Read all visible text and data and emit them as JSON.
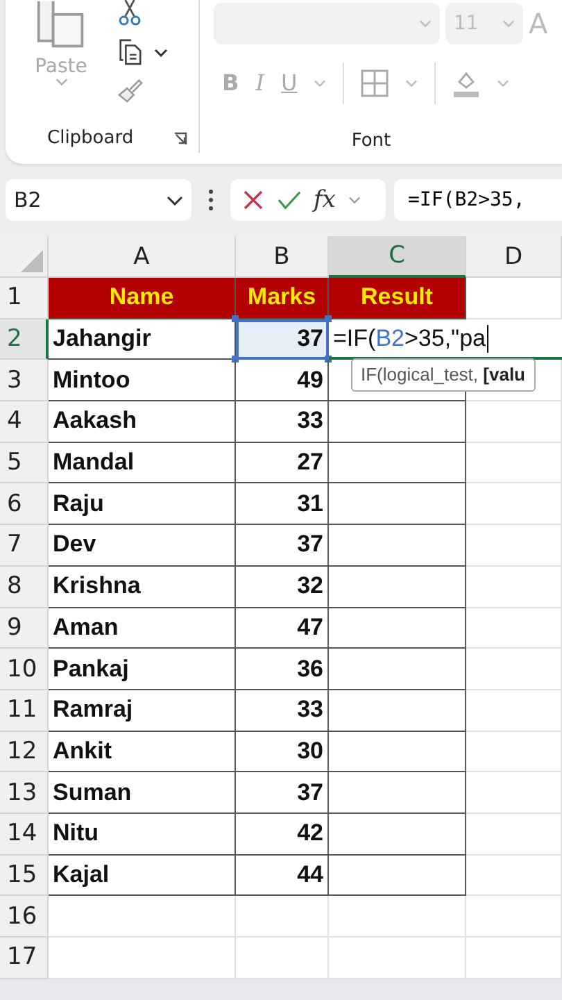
{
  "ribbon": {
    "clipboard": {
      "paste_label": "Paste",
      "group_label": "Clipboard"
    },
    "font": {
      "size": "11",
      "grow": "A",
      "bold": "B",
      "italic": "I",
      "underline": "U",
      "group_label": "Font"
    }
  },
  "formula_bar": {
    "name_box": "B2",
    "fx": "fx",
    "formula": "=IF(B2>35,"
  },
  "columns": [
    {
      "label": "A",
      "selected": false
    },
    {
      "label": "B",
      "selected": false
    },
    {
      "label": "C",
      "selected": true
    },
    {
      "label": "D",
      "selected": false
    }
  ],
  "edit_cell": {
    "parts": [
      {
        "kind": "plain",
        "text": "=IF("
      },
      {
        "kind": "ref",
        "text": "B2"
      },
      {
        "kind": "plain",
        "text": ">35,\"pa"
      }
    ],
    "tooltip": "IF(logical_test, **[valu**"
  },
  "rows": [
    {
      "number": "1",
      "selected": false,
      "kind": "header",
      "name": "Name",
      "marks": "Marks",
      "result": "Result"
    },
    {
      "number": "2",
      "selected": true,
      "kind": "data",
      "name": "Jahangir",
      "marks": "37",
      "referenced": true,
      "editing": true
    },
    {
      "number": "3",
      "selected": false,
      "kind": "data",
      "name": "Mintoo",
      "marks": "49",
      "referenced": false,
      "editing": false
    },
    {
      "number": "4",
      "selected": false,
      "kind": "data",
      "name": "Aakash",
      "marks": "33",
      "referenced": false,
      "editing": false
    },
    {
      "number": "5",
      "selected": false,
      "kind": "data",
      "name": "Mandal",
      "marks": "27",
      "referenced": false,
      "editing": false
    },
    {
      "number": "6",
      "selected": false,
      "kind": "data",
      "name": "Raju",
      "marks": "31",
      "referenced": false,
      "editing": false
    },
    {
      "number": "7",
      "selected": false,
      "kind": "data",
      "name": "Dev",
      "marks": "37",
      "referenced": false,
      "editing": false
    },
    {
      "number": "8",
      "selected": false,
      "kind": "data",
      "name": "Krishna",
      "marks": "32",
      "referenced": false,
      "editing": false
    },
    {
      "number": "9",
      "selected": false,
      "kind": "data",
      "name": "Aman",
      "marks": "47",
      "referenced": false,
      "editing": false
    },
    {
      "number": "10",
      "selected": false,
      "kind": "data",
      "name": "Pankaj",
      "marks": "36",
      "referenced": false,
      "editing": false
    },
    {
      "number": "11",
      "selected": false,
      "kind": "data",
      "name": "Ramraj",
      "marks": "33",
      "referenced": false,
      "editing": false
    },
    {
      "number": "12",
      "selected": false,
      "kind": "data",
      "name": "Ankit",
      "marks": "30",
      "referenced": false,
      "editing": false
    },
    {
      "number": "13",
      "selected": false,
      "kind": "data",
      "name": "Suman",
      "marks": "37",
      "referenced": false,
      "editing": false
    },
    {
      "number": "14",
      "selected": false,
      "kind": "data",
      "name": "Nitu",
      "marks": "42",
      "referenced": false,
      "editing": false
    },
    {
      "number": "15",
      "selected": false,
      "kind": "data",
      "name": "Kajal",
      "marks": "44",
      "referenced": false,
      "editing": false
    },
    {
      "number": "16",
      "selected": false,
      "kind": "empty"
    },
    {
      "number": "17",
      "selected": false,
      "kind": "empty"
    }
  ]
}
